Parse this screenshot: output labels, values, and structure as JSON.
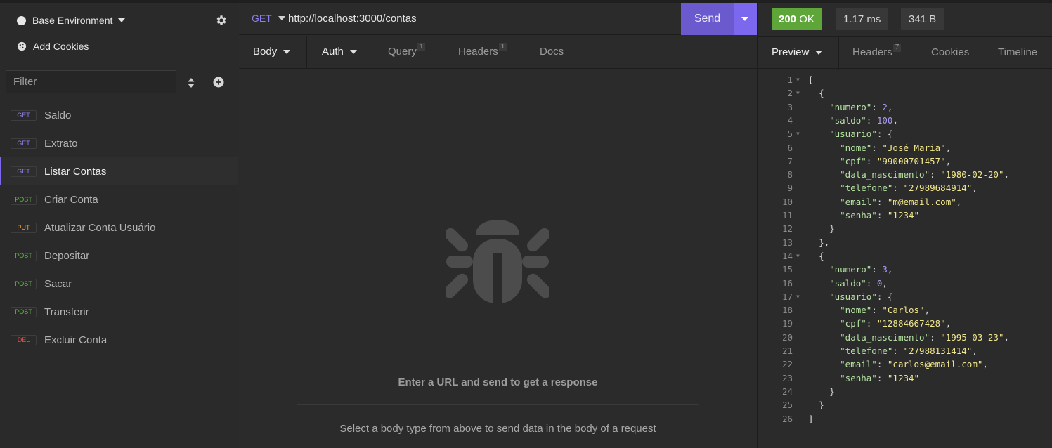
{
  "sidebar": {
    "environment": "Base Environment",
    "add_cookies": "Add Cookies",
    "filter_placeholder": "Filter",
    "requests": [
      {
        "method": "GET",
        "name": "Saldo",
        "color": "#8c7ff0"
      },
      {
        "method": "GET",
        "name": "Extrato",
        "color": "#8c7ff0"
      },
      {
        "method": "GET",
        "name": "Listar Contas",
        "color": "#8c7ff0",
        "active": true
      },
      {
        "method": "POST",
        "name": "Criar Conta",
        "color": "#5fbb46"
      },
      {
        "method": "PUT",
        "name": "Atualizar Conta Usuário",
        "color": "#ff9a2e"
      },
      {
        "method": "POST",
        "name": "Depositar",
        "color": "#5fbb46"
      },
      {
        "method": "POST",
        "name": "Sacar",
        "color": "#5fbb46"
      },
      {
        "method": "POST",
        "name": "Transferir",
        "color": "#5fbb46"
      },
      {
        "method": "DEL",
        "name": "Excluir Conta",
        "color": "#e8514b"
      }
    ]
  },
  "request": {
    "method": "GET",
    "url": "http://localhost:3000/contas",
    "send_label": "Send",
    "tabs": {
      "body": "Body",
      "auth": "Auth",
      "query": "Query",
      "query_count": "1",
      "headers": "Headers",
      "headers_count": "1",
      "docs": "Docs"
    },
    "empty_title": "Enter a URL and send to get a response",
    "empty_hint": "Select a body type from above to send data in the body of a request"
  },
  "response": {
    "status": "200",
    "status_text": "OK",
    "time": "1.17 ms",
    "size": "341 B",
    "tabs": {
      "preview": "Preview",
      "headers": "Headers",
      "headers_count": "7",
      "cookies": "Cookies",
      "timeline": "Timeline"
    },
    "body_lines": [
      "[",
      "  {",
      "    \"numero\": 2,",
      "    \"saldo\": 100,",
      "    \"usuario\": {",
      "      \"nome\": \"José Maria\",",
      "      \"cpf\": \"99000701457\",",
      "      \"data_nascimento\": \"1980-02-20\",",
      "      \"telefone\": \"27989684914\",",
      "      \"email\": \"m@email.com\",",
      "      \"senha\": \"1234\"",
      "    }",
      "  },",
      "  {",
      "    \"numero\": 3,",
      "    \"saldo\": 0,",
      "    \"usuario\": {",
      "      \"nome\": \"Carlos\",",
      "      \"cpf\": \"12884667428\",",
      "      \"data_nascimento\": \"1995-03-23\",",
      "      \"telefone\": \"27988131414\",",
      "      \"email\": \"carlos@email.com\",",
      "      \"senha\": \"1234\"",
      "    }",
      "  }",
      "]"
    ],
    "foldable_lines": [
      1,
      2,
      5,
      14,
      17
    ]
  }
}
